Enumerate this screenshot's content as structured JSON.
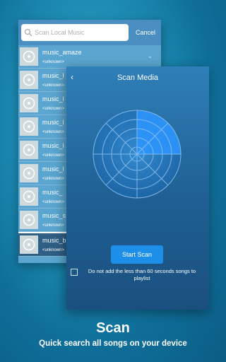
{
  "search": {
    "placeholder": "Scan Local Music",
    "cancel_label": "Cancel"
  },
  "songs": [
    {
      "title": "music_amaze",
      "artist": "<unknown>"
    },
    {
      "title": "music_l",
      "artist": "<unknown>"
    },
    {
      "title": "music_l",
      "artist": "<unknown>"
    },
    {
      "title": "music_l",
      "artist": "<unknown>"
    },
    {
      "title": "music_l",
      "artist": "<unknown>"
    },
    {
      "title": "music_l",
      "artist": "<unknown>"
    },
    {
      "title": "music_",
      "artist": "<unknown>"
    },
    {
      "title": "music_s",
      "artist": "<unknown>"
    },
    {
      "title": "music_b",
      "artist": "<unknown>"
    }
  ],
  "scan": {
    "title": "Scan Media",
    "start_label": "Start Scan",
    "checkbox_label": "Do not add the less than 60 seconds songs to playlist",
    "checkbox_checked": false
  },
  "caption": {
    "title": "Scan",
    "subtitle": "Quick search all songs on your device"
  },
  "colors": {
    "accent": "#1d8fe8",
    "header": "#4b8ec1"
  },
  "icons": {
    "back": "chevron-left-icon",
    "search": "search-icon",
    "expand": "chevron-down-icon",
    "thumb": "music-disc-icon"
  }
}
